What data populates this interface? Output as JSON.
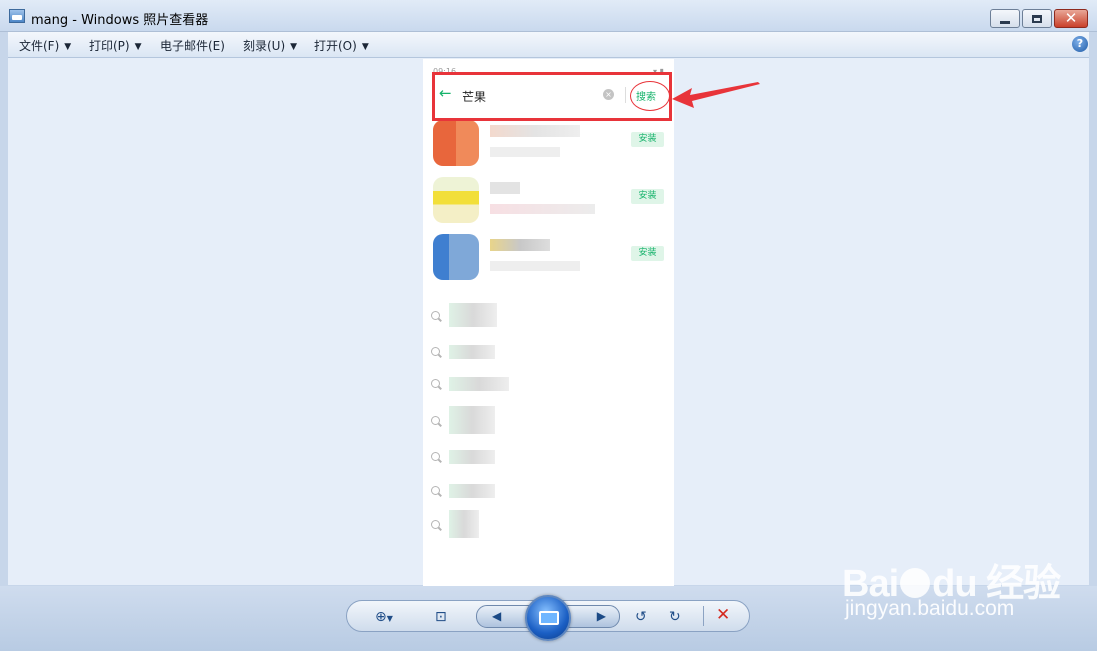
{
  "window": {
    "title": "mang - Windows 照片查看器"
  },
  "menu": {
    "items": [
      "文件(F)",
      "打印(P)",
      "电子邮件(E)",
      "刻录(U)",
      "打开(O)"
    ],
    "help": "?"
  },
  "phone": {
    "status_left": "09:16",
    "search": {
      "query": "芒果",
      "search_button": "搜索"
    },
    "results": [
      {
        "install": "安装"
      },
      {
        "install": "安装"
      },
      {
        "install": "安装"
      }
    ]
  },
  "toolbar": {
    "zoom_icon": "zoom-icon",
    "fit_icon": "fit-to-window-icon",
    "prev_icon": "previous-icon",
    "slideshow_icon": "slideshow-icon",
    "next_icon": "next-icon",
    "rotate_ccw_icon": "rotate-counterclockwise-icon",
    "rotate_cw_icon": "rotate-clockwise-icon",
    "delete_icon": "delete-icon"
  },
  "annotation": {
    "color": "#e8343a"
  },
  "watermark": {
    "logo_left": "Bai",
    "logo_right": "du 经验",
    "url": "jingyan.baidu.com"
  }
}
